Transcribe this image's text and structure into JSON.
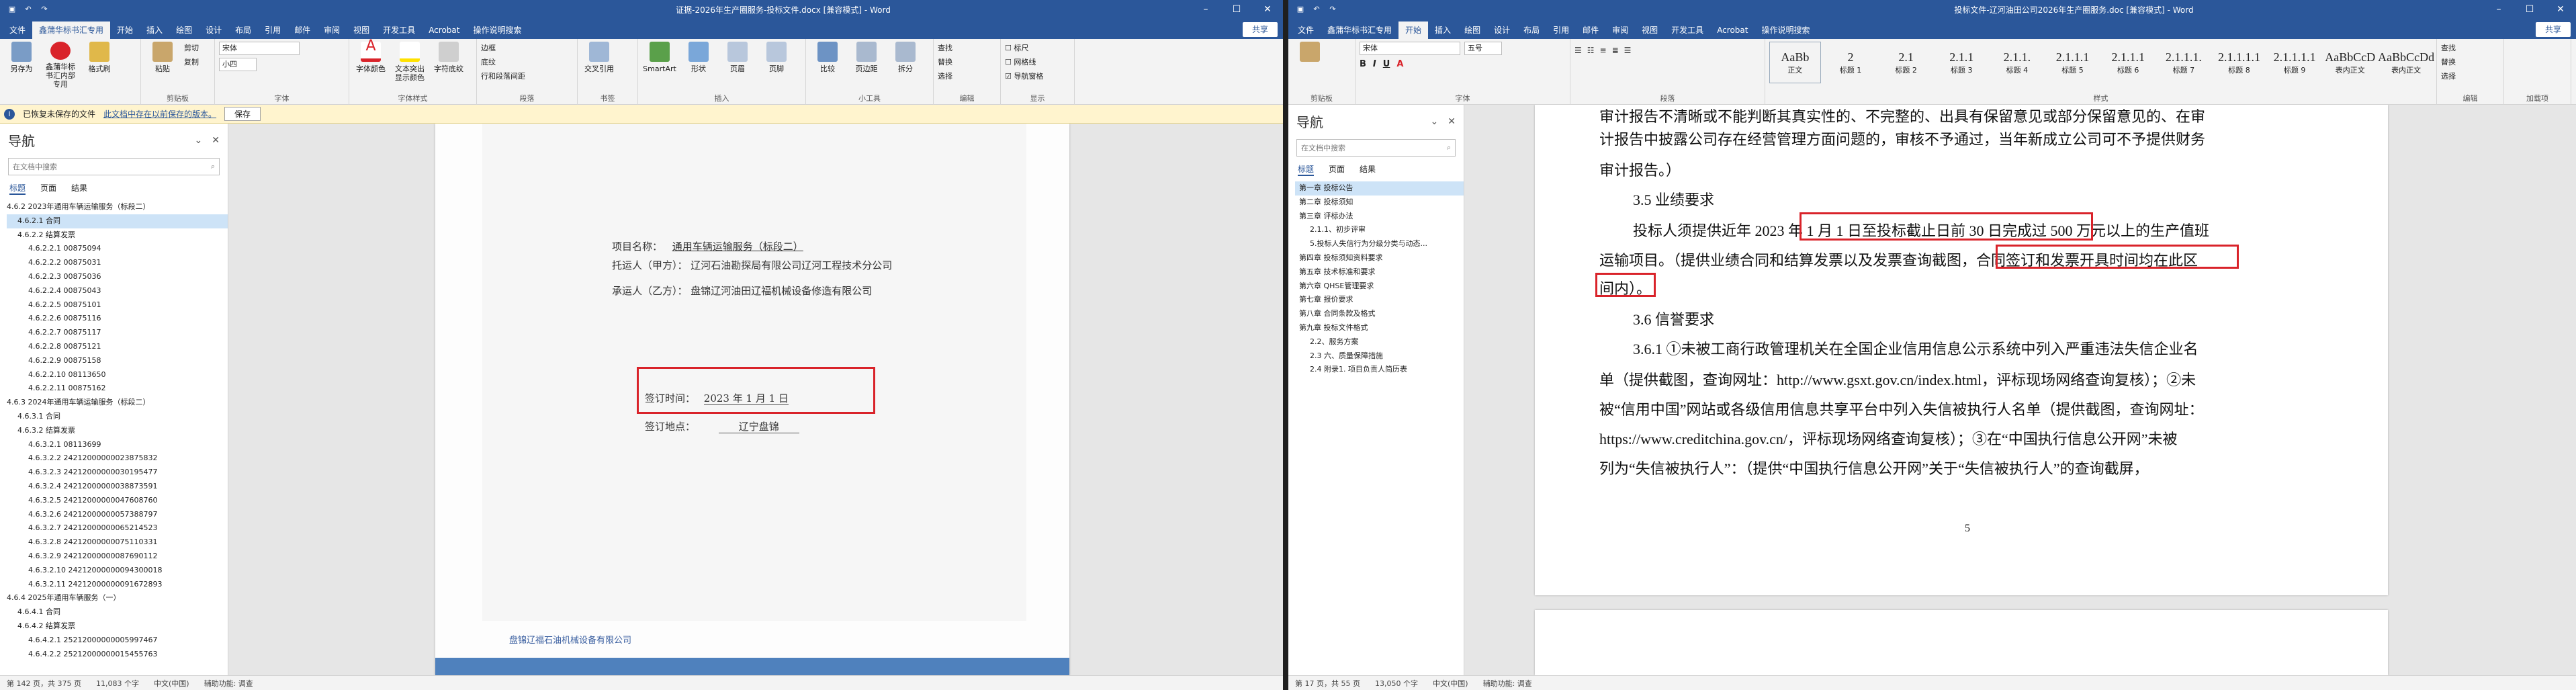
{
  "left": {
    "qat_icons": [
      "save-icon",
      "undo-icon",
      "redo-icon"
    ],
    "title": "证据-2026年生产圈服务-投标文件.docx [兼容模式] - Word",
    "tabs": [
      "文件",
      "鑫蒲华标书汇专用",
      "开始",
      "插入",
      "绘图",
      "设计",
      "布局",
      "引用",
      "邮件",
      "审阅",
      "视图",
      "开发工具",
      "Acrobat",
      "操作说明搜索"
    ],
    "share": "共享",
    "ribbon": {
      "groups": [
        {
          "label": "",
          "buttons": [
            "另存为",
            "鑫蒲华标书汇内部专用",
            "格式刷"
          ]
        },
        {
          "label": "剪贴板",
          "buttons": [
            "粘贴",
            "剪切",
            "复制"
          ]
        },
        {
          "label": "字体",
          "font": "宋体",
          "size": "小四"
        },
        {
          "label": "字体样式",
          "buttons": [
            "字体颜色",
            "文本突出显示颜色",
            "字符底纹"
          ]
        },
        {
          "label": "段落",
          "items": [
            "边框",
            "底纹",
            "行和段落间距"
          ]
        },
        {
          "label": "书签",
          "buttons": [
            "交叉引用"
          ]
        },
        {
          "label": "插入",
          "buttons": [
            "SmartArt",
            "形状",
            "页眉",
            "页脚"
          ]
        },
        {
          "label": "小工具",
          "buttons": [
            "比较",
            "页边距",
            "拆分"
          ]
        },
        {
          "label": "编辑",
          "items": [
            "查找",
            "替换",
            "选择"
          ]
        },
        {
          "label": "显示",
          "items": [
            "标尺",
            "网格线",
            "导航窗格"
          ]
        }
      ]
    },
    "msgbar": {
      "text": "已恢复未保存的文件",
      "link": "此文档中存在以前保存的版本。",
      "button": "保存"
    },
    "nav": {
      "title": "导航",
      "search_placeholder": "在文档中搜索",
      "tabs": [
        "标题",
        "页面",
        "结果"
      ],
      "nodes": [
        "4.6.2 2023年通用车辆运输服务（标段二）",
        "4.6.2.1 合同",
        "4.6.2.2 结算发票",
        "4.6.2.2.1 00875094",
        "4.6.2.2.2 00875031",
        "4.6.2.2.3 00875036",
        "4.6.2.2.4 00875043",
        "4.6.2.2.5 00875101",
        "4.6.2.2.6 00875116",
        "4.6.2.2.7 00875117",
        "4.6.2.2.8 00875121",
        "4.6.2.2.9 00875158",
        "4.6.2.2.10 08113650",
        "4.6.2.2.11 00875162",
        "4.6.3 2024年通用车辆运输服务（标段二）",
        "4.6.3.1 合同",
        "4.6.3.2 结算发票",
        "4.6.3.2.1 08113699",
        "4.6.3.2.2 24212000000023875832",
        "4.6.3.2.3 24212000000030195477",
        "4.6.3.2.4 24212000000038873591",
        "4.6.3.2.5 24212000000047608760",
        "4.6.3.2.6 24212000000057388797",
        "4.6.3.2.7 24212000000065214523",
        "4.6.3.2.8 24212000000075110331",
        "4.6.3.2.9 24212000000087690112",
        "4.6.3.2.10 24212000000094300018",
        "4.6.3.2.11 24212000000091672893",
        "4.6.4 2025年通用车辆服务（一）",
        "4.6.4.1 合同",
        "4.6.4.2 结算发票",
        "4.6.4.2.1 25212000000005997467",
        "4.6.4.2.2 25212000000015455763"
      ]
    },
    "scan": {
      "line1_label": "项目名称：",
      "line1_value": "通用车辆运输服务（标段二）",
      "line2_label": "托运人（甲方）：",
      "line2_value": "辽河石油勘探局有限公司辽河工程技术分公司",
      "line3_label": "承运人（乙方）：",
      "line3_value": "盘锦辽河油田辽福机械设备修造有限公司",
      "sign_time_label": "签订时间：",
      "sign_time_value": "2023 年 1 月 1 日",
      "sign_place_label": "签订地点：",
      "sign_place_value": "辽宁盘锦",
      "footer_text": "盘锦辽福石油机械设备有限公司"
    },
    "status": [
      "第 142 页，共 375 页",
      "11,083 个字",
      "中文(中国)",
      "辅助功能: 调查"
    ]
  },
  "right": {
    "qat_icons": [
      "save-icon",
      "undo-icon",
      "redo-icon"
    ],
    "title": "投标文件-辽河油田公司2026年生产圈服务.doc [兼容模式] - Word",
    "tabs": [
      "文件",
      "鑫蒲华标书汇专用",
      "开始",
      "插入",
      "绘图",
      "设计",
      "布局",
      "引用",
      "邮件",
      "审阅",
      "视图",
      "开发工具",
      "Acrobat",
      "操作说明搜索"
    ],
    "share": "共享",
    "font": "宋体",
    "size": "五号",
    "styles": [
      {
        "sample": "AaBb",
        "name": "正文"
      },
      {
        "sample": "2",
        "name": "标题 1"
      },
      {
        "sample": "2.1",
        "name": "标题 2"
      },
      {
        "sample": "2.1.1",
        "name": "标题 3"
      },
      {
        "sample": "2.1.1.",
        "name": "标题 4"
      },
      {
        "sample": "2.1.1.1",
        "name": "标题 5"
      },
      {
        "sample": "2.1.1.1",
        "name": "标题 6"
      },
      {
        "sample": "2.1.1.1.",
        "name": "标题 7"
      },
      {
        "sample": "2.1.1.1.1",
        "name": "标题 8"
      },
      {
        "sample": "2.1.1.1.1",
        "name": "标题 9"
      },
      {
        "sample": "AaBbCcD",
        "name": "表内正文"
      },
      {
        "sample": "AaBbCcDd",
        "name": "表内正文"
      }
    ],
    "edit_items": [
      "查找",
      "替换",
      "选择"
    ],
    "group_labels": [
      "剪贴板",
      "字体",
      "段落",
      "样式",
      "编辑",
      "加载项"
    ],
    "nav": {
      "title": "导航",
      "search_placeholder": "在文档中搜索",
      "tabs": [
        "标题",
        "页面",
        "结果"
      ],
      "nodes": [
        "第一章 投标公告",
        "第二章 投标须知",
        "第三章 评标办法",
        "2.1.1、初步评审",
        "5.投标人失信行为分级分类与动态...",
        "第四章 投标须知资料要求",
        "第五章 技术标准和要求",
        "第六章 QHSE管理要求",
        "第七章 报价要求",
        "第八章 合同条款及格式",
        "第九章 投标文件格式",
        "2.2、服务方案",
        "2.3 六、质量保障措施",
        "2.4 附录1. 项目负责人简历表"
      ]
    },
    "doc": {
      "p1": "审计报告不清晰或不能判断其真实性的、不完整的、出具有保留意见或部分保留意见的、在审",
      "p2": "计报告中披露公司存在经营管理方面问题的，审核不予通过，当年新成立公司可不予提供财务",
      "p3": "审计报告。）",
      "h1": "3.5 业绩要求",
      "p4a": "投标人须提供近",
      "p4b": "年 2023 年 1 月 1 日至投标截止日前 30 日完",
      "p4c": "成过 500 万元以上的生产值班",
      "p5a": "运输项目。（提供业绩合同和结算发票以及发票查询截图，",
      "p5b": "合同签订和发票开具时间均在此区",
      "p6": "间内）。",
      "h2": "3.6 信誉要求",
      "p7": "3.6.1 ①未被工商行政管理机关在全国企业信用信息公示系统中列入严重违法失信企业名",
      "p8": "单（提供截图，查询网址：http://www.gsxt.gov.cn/index.html，评标现场网络查询复核）；②未",
      "p9": "被“信用中国”网站或各级信用信息共享平台中列入失信被执行人名单（提供截图，查询网址：",
      "p10": "https://www.creditchina.gov.cn/，评标现场网络查询复核）；③在“中国执行信息公开网”未被",
      "p11": "列为“失信被执行人”：（提供“中国执行信息公开网”关于“失信被执行人”的查询截屏，",
      "page_number": "5"
    },
    "status": [
      "第 17 页，共 55 页",
      "13,050 个字",
      "中文(中国)",
      "辅助功能: 调查"
    ]
  },
  "colors": {
    "word_blue": "#2b579a",
    "highlight_red": "#d9232a",
    "msgbar_yellow": "#fff4ce"
  }
}
